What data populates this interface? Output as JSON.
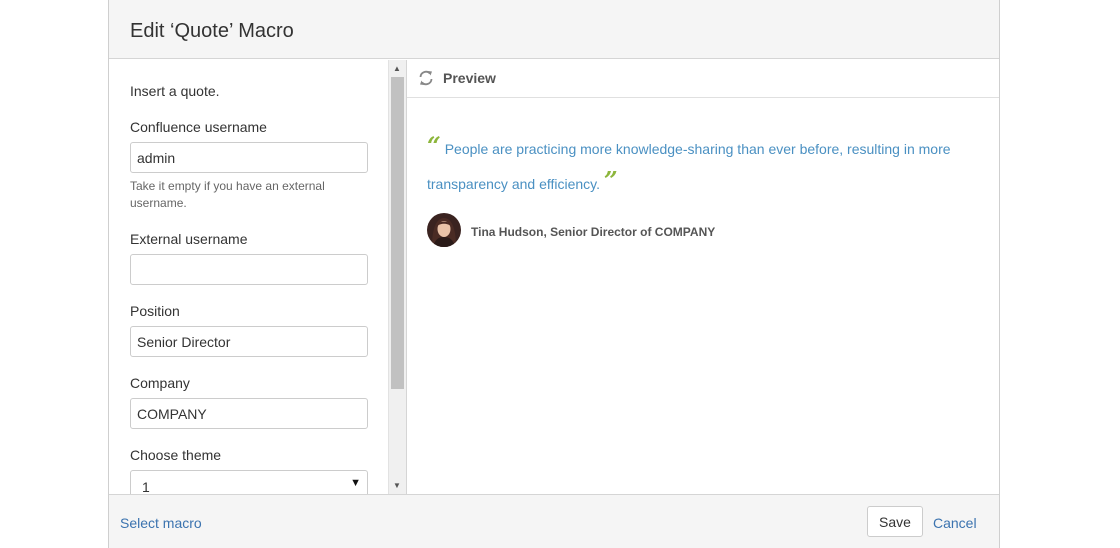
{
  "dialog": {
    "title": "Edit ‘Quote’ Macro"
  },
  "form": {
    "intro": "Insert a quote.",
    "fields": {
      "confluence_username": {
        "label": "Confluence username",
        "value": "admin",
        "help": "Take it empty if you have an external username."
      },
      "external_username": {
        "label": "External username",
        "value": ""
      },
      "position": {
        "label": "Position",
        "value": "Senior Director"
      },
      "company": {
        "label": "Company",
        "value": "COMPANY"
      },
      "theme": {
        "label": "Choose theme",
        "value": "1"
      }
    }
  },
  "preview": {
    "title": "Preview",
    "icon": "refresh-icon",
    "quote_open": "“",
    "quote_text": "People are practicing more knowledge-sharing than ever before, resulting in more transparency and efficiency.",
    "quote_close": "”",
    "author": "Tina Hudson, Senior Director of COMPANY",
    "colors": {
      "quote_text": "#4a90c2",
      "quote_marks": "#8db63c"
    }
  },
  "footer": {
    "select_macro": "Select macro",
    "save": "Save",
    "cancel": "Cancel"
  }
}
